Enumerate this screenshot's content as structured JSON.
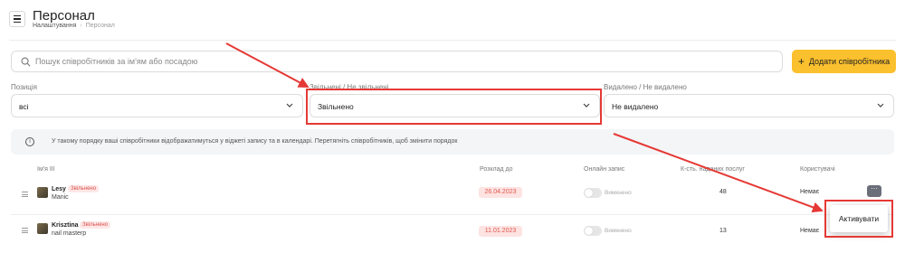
{
  "header": {
    "title": "Персонал",
    "breadcrumb": [
      "Налаштування",
      "Персонал"
    ]
  },
  "search": {
    "placeholder": "Пошук співробітників за ім'ям або посадою",
    "value": ""
  },
  "add_button": {
    "label": "Додати співробітника"
  },
  "filters": [
    {
      "label": "Позиція",
      "value": "всі"
    },
    {
      "label": "Звільнені / Не звільнені",
      "value": "Звільнено"
    },
    {
      "label": "Видалено / Не видалено",
      "value": "Не видалено"
    }
  ],
  "info": {
    "text": "У такому порядку ваші співробітники відображатимуться у віджеті запису та в календарі. Перетягніть співробітників, щоб змінити порядок"
  },
  "table": {
    "columns": [
      "Ім'я ІІІ",
      "Розклад до",
      "Онлайн запис",
      "К-сть. наданих послуг",
      "Користувачі"
    ],
    "rows": [
      {
        "name": "Lesy",
        "badge": "Звільнено",
        "position": "Manic",
        "schedule_until": "26.04.2023",
        "online_label": "Вимкнено",
        "online_enabled": false,
        "services_count": "48",
        "user": "Немає",
        "more": "···"
      },
      {
        "name": "Krisztina",
        "badge": "Звільнено",
        "position": "nail masterp",
        "schedule_until": "11.01.2023",
        "online_label": "Вимкнено",
        "online_enabled": false,
        "services_count": "13",
        "user": "Немає"
      }
    ]
  },
  "popover": {
    "label": "Активувати"
  },
  "colors": {
    "accent": "#fbc02d",
    "annotation": "#e53935",
    "danger": "#e2574c"
  },
  "icons": [
    "menu-icon",
    "search-icon",
    "plus-icon",
    "chevron-down-icon",
    "info-icon",
    "drag-handle-icon",
    "more-icon"
  ]
}
